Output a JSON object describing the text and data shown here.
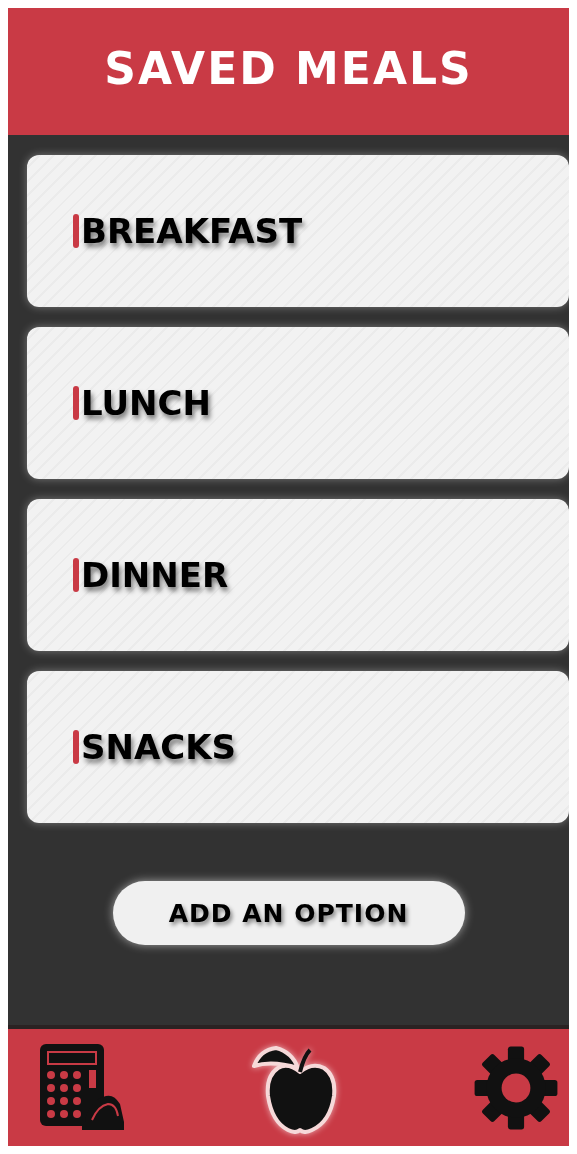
{
  "header": {
    "title": "SAVED MEALS"
  },
  "meals": [
    {
      "label": "BREAKFAST"
    },
    {
      "label": "LUNCH"
    },
    {
      "label": "DINNER"
    },
    {
      "label": "SNACKS"
    }
  ],
  "add_button": {
    "label": "ADD AN OPTION"
  },
  "nav": [
    {
      "kind": "calculator",
      "selected": false
    },
    {
      "kind": "apple",
      "selected": true
    },
    {
      "kind": "settings",
      "selected": false
    }
  ]
}
